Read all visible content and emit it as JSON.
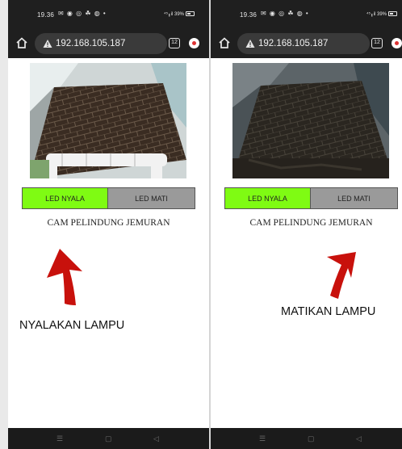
{
  "screens": [
    {
      "status": {
        "time": "19.36",
        "notif_icons": "✉ ◉ ◎ ☘ ◍ •",
        "system": "⁴⁵╻il 39%"
      },
      "browser": {
        "url": "192.168.105.187",
        "tab_count": "12"
      },
      "page": {
        "led_on_label": "LED NYALA",
        "led_off_label": "LED MATI",
        "title": "CAM PELINDUNG JEMURAN"
      },
      "caption": "NYALAKAN LAMPU",
      "nav": {
        "menu": "☰",
        "home": "▢",
        "back": "◁"
      }
    },
    {
      "status": {
        "time": "19.36",
        "notif_icons": "✉ ◉ ◎ ☘ ◍ •",
        "system": "⁴⁵╻il 39%"
      },
      "browser": {
        "url": "192.168.105.187",
        "tab_count": "12"
      },
      "page": {
        "led_on_label": "LED NYALA",
        "led_off_label": "LED MATI",
        "title": "CAM PELINDUNG JEMURAN"
      },
      "caption": "MATIKAN LAMPU",
      "nav": {
        "menu": "☰",
        "home": "▢",
        "back": "◁"
      }
    }
  ],
  "colors": {
    "led_on": "#7ffb13",
    "led_off": "#9a9a9a",
    "arrow": "#c8110c",
    "chrome": "#1f1f1f"
  }
}
